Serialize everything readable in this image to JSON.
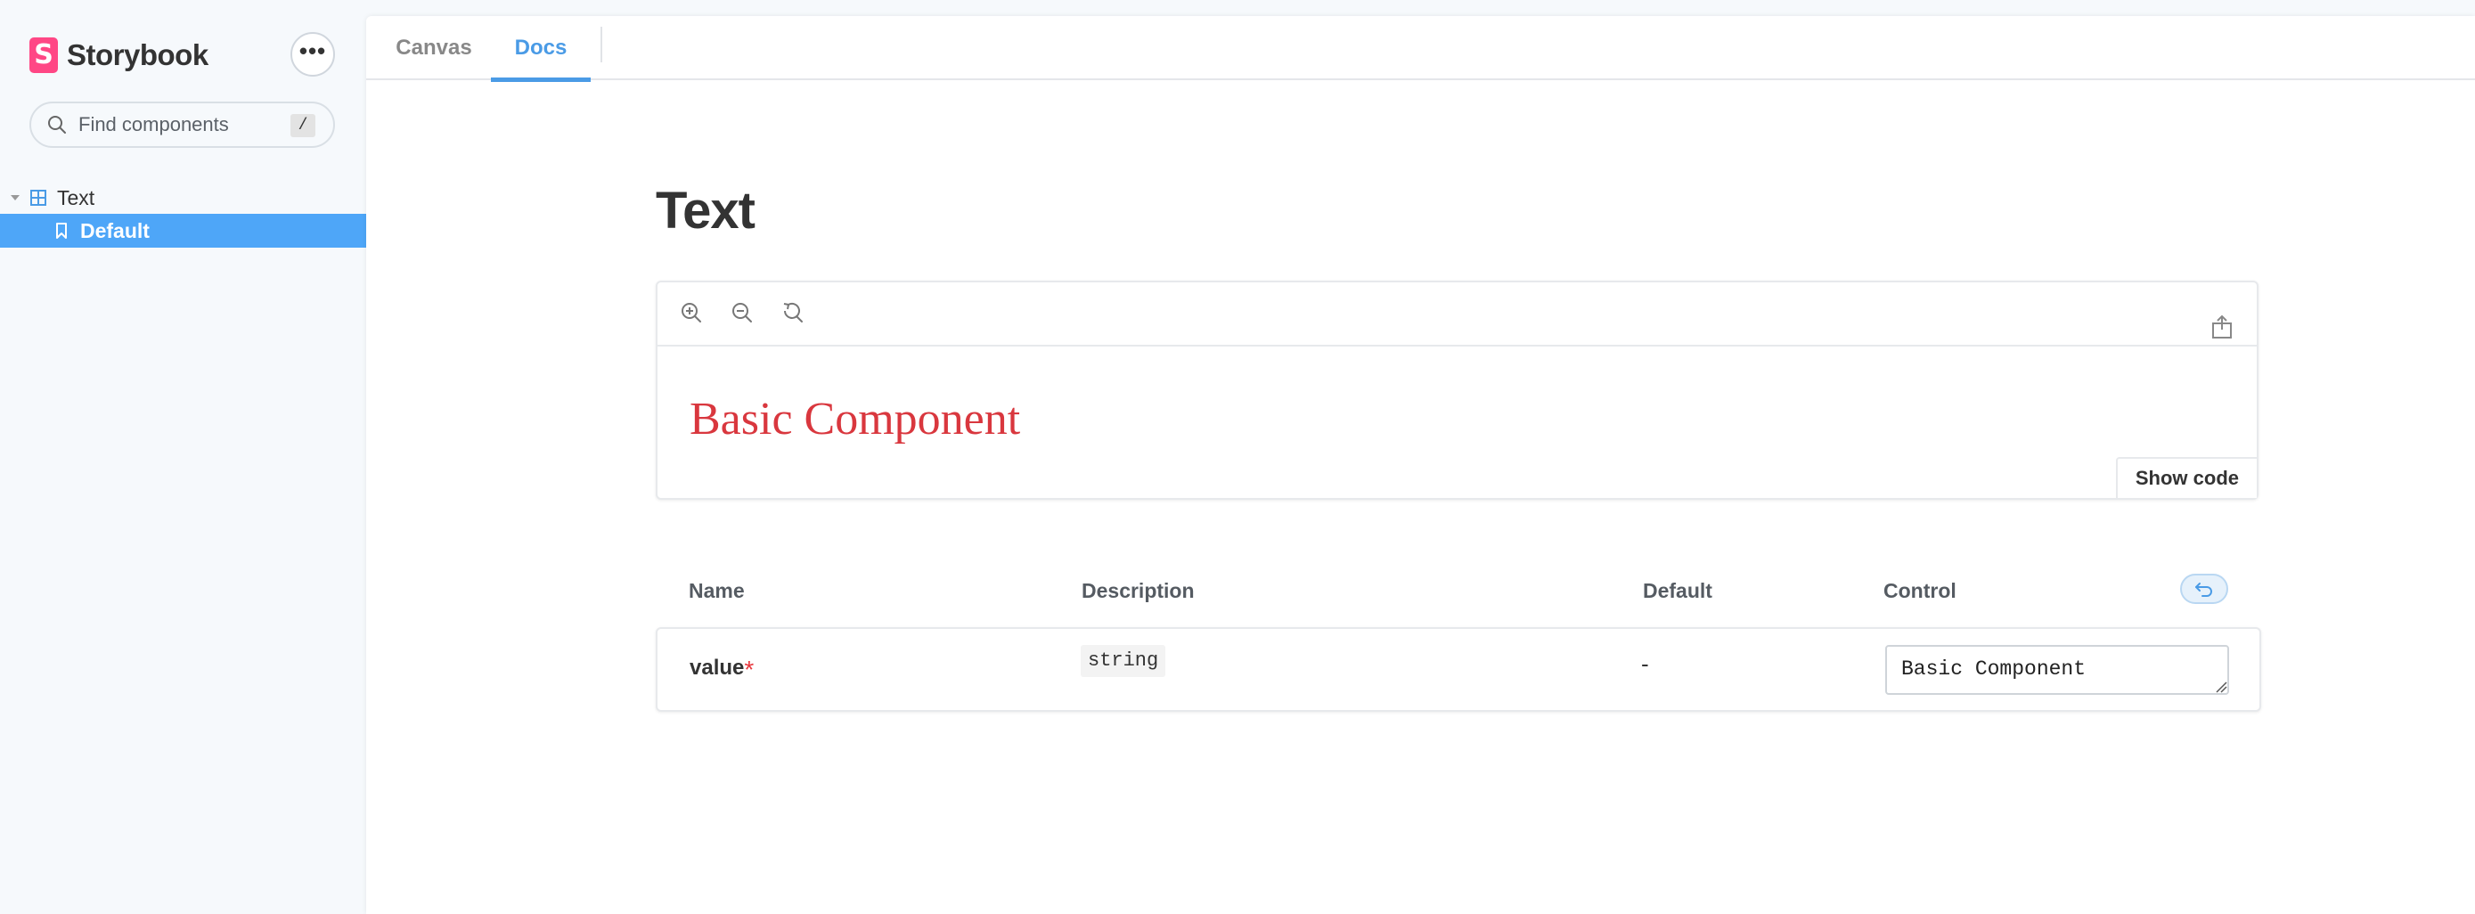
{
  "sidebar": {
    "brand": {
      "logo_letter": "S",
      "name": "Storybook",
      "logo_color": "#ff4785"
    },
    "menu_button_label": "•••",
    "search": {
      "placeholder": "Find components",
      "shortcut": "/"
    },
    "tree": {
      "group_label": "Text",
      "items": [
        {
          "label": "Default",
          "selected": true
        }
      ]
    },
    "selected_color": "#4ea6f8"
  },
  "tabs": [
    {
      "label": "Canvas",
      "active": false
    },
    {
      "label": "Docs",
      "active": true
    }
  ],
  "docs": {
    "title": "Text",
    "preview": {
      "toolbar_icons": [
        "zoom-in-icon",
        "zoom-out-icon",
        "zoom-reset-icon",
        "share-icon"
      ],
      "story_text": "Basic Component",
      "story_text_color": "#d9373e",
      "show_code_label": "Show code"
    },
    "args_table": {
      "headers": {
        "name": "Name",
        "description": "Description",
        "default": "Default",
        "control": "Control"
      },
      "rows": [
        {
          "name": "value",
          "required_mark": "*",
          "type": "string",
          "default": "-",
          "control_value": "Basic Component"
        }
      ]
    }
  },
  "accent_color": "#4a9be6"
}
